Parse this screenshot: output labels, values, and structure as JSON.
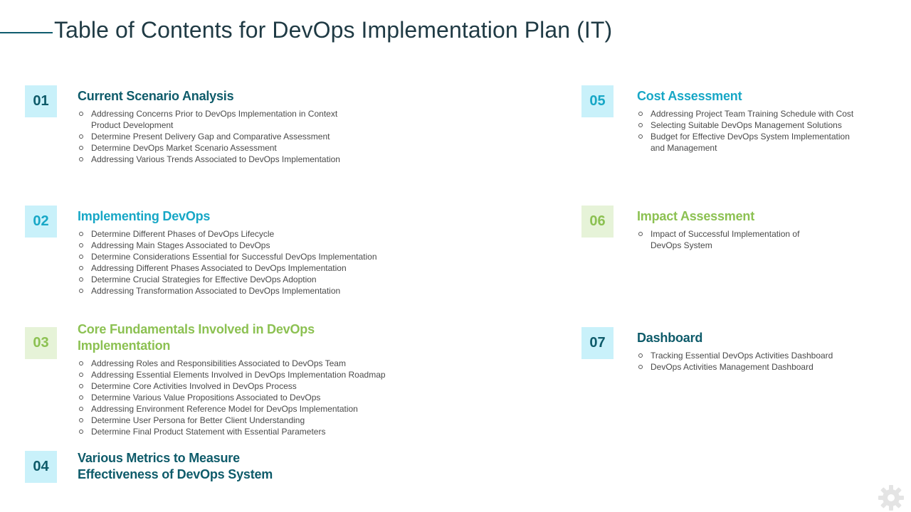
{
  "title": "Table of Contents for DevOps Implementation Plan (IT)",
  "colors": {
    "dark_teal": "#0e5b6a",
    "teal": "#17a7c6",
    "green": "#8cc152",
    "box_blue": "#c9f1fa",
    "box_green": "#e6f3d8"
  },
  "sections": [
    {
      "number": "01",
      "title_lines": [
        "Current Scenario Analysis"
      ],
      "items": [
        [
          "Addressing Concerns Prior to DevOps  Implementation  in Context",
          "Product Development"
        ],
        [
          "Determine Present Delivery  Gap and Comparative  Assessment"
        ],
        [
          "Determine DevOps  Market Scenario Assessment"
        ],
        [
          "Addressing Various Trends  Associated to DevOps  Implementation"
        ]
      ]
    },
    {
      "number": "02",
      "title_lines": [
        "Implementing DevOps"
      ],
      "items": [
        [
          "Determine Different  Phases of DevOps  Lifecycle"
        ],
        [
          "Addressing Main Stages Associated to DevOps"
        ],
        [
          "Determine Considerations  Essential for Successful DevOps  Implementation"
        ],
        [
          "Addressing Different  Phases Associated to DevOps  Implementation"
        ],
        [
          "Determine Crucial Strategies for Effective DevOps  Adoption"
        ],
        [
          "Addressing Transformation  Associated to DevOps  Implementation"
        ]
      ]
    },
    {
      "number": "03",
      "title_lines": [
        "Core Fundamentals Involved in DevOps",
        "Implementation"
      ],
      "items": [
        [
          "Addressing Roles and Responsibilities Associated to DevOps  Team"
        ],
        [
          "Addressing Essential Elements Involved  in DevOps  Implementation Roadmap"
        ],
        [
          "Determine Core Activities Involved  in DevOps  Process"
        ],
        [
          "Determine Various Value Propositions Associated to DevOps"
        ],
        [
          "Addressing Environment  Reference  Model for DevOps  Implementation"
        ],
        [
          "Determine User Persona for Better Client Understanding"
        ],
        [
          "Determine Final Product Statement with Essential Parameters"
        ]
      ]
    },
    {
      "number": "04",
      "title_lines": [
        "Various Metrics to Measure",
        "Effectiveness of  DevOps System"
      ],
      "items": []
    },
    {
      "number": "05",
      "title_lines": [
        "Cost Assessment"
      ],
      "items": [
        [
          "Addressing Project Team Training Schedule with Cost"
        ],
        [
          "Selecting Suitable DevOps  Management  Solutions"
        ],
        [
          "Budget for Effective DevOps  System Implementation",
          "and Management"
        ]
      ]
    },
    {
      "number": "06",
      "title_lines": [
        "Impact Assessment"
      ],
      "items": [
        [
          "Impact of Successful Implementation  of",
          "DevOps  System"
        ]
      ]
    },
    {
      "number": "07",
      "title_lines": [
        "Dashboard"
      ],
      "items": [
        [
          "Tracking  Essential DevOps  Activities Dashboard"
        ],
        [
          "DevOps  Activities Management  Dashboard"
        ]
      ]
    }
  ],
  "footer": {
    "icon": "gear-icon"
  }
}
